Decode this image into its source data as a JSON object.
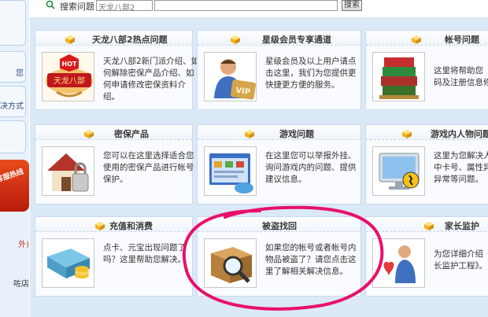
{
  "search": {
    "label": "搜索问题",
    "selected_scope": "天龙八部2",
    "query": "",
    "button_label": "搜索"
  },
  "sidebar": {
    "items": [
      {
        "label": ""
      },
      {
        "label": "您"
      },
      {
        "label": "决方式"
      },
      {
        "label": ""
      }
    ],
    "promo_text": "客服热线",
    "bottom_texts": [
      "外)",
      "咗店"
    ]
  },
  "cards": [
    {
      "title": "天龙八部2热点问题",
      "image": "hot-topic-icon",
      "desc": [
        "天龙八部2新门派介绍、如",
        "何解除密保产品介绍、如",
        "何申请修改密保资料介",
        "绍。"
      ]
    },
    {
      "title": "星级会员专享通道",
      "image": "vip-member-icon",
      "desc": [
        "星级会员及以上用户请点",
        "击这里，我们为您提供更",
        "快捷更方便的服务。"
      ]
    },
    {
      "title": "帐号问题",
      "image": "account-books-icon",
      "desc": [
        "这里将帮助您",
        "码及注册信息修"
      ]
    },
    {
      "title": "密保产品",
      "image": "security-house-icon",
      "desc": [
        "您可以在这里选择适合您",
        "使用的密保产品进行帐号",
        "保护。"
      ]
    },
    {
      "title": "游戏问题",
      "image": "game-window-icon",
      "desc": [
        "在这里您可以举报外挂、",
        "询问游戏内的问题、提供",
        "建议信息。"
      ]
    },
    {
      "title": "游戏内人物问题",
      "image": "character-monitor-icon",
      "desc": [
        "这里为您解决人",
        "中卡号、属性异",
        "异常等问题。"
      ]
    },
    {
      "title": "充值和消费",
      "image": "recharge-cards-icon",
      "desc": [
        "点卡、元宝出现问题了",
        "吗？这里帮助您解决。"
      ]
    },
    {
      "title": "被盗找回",
      "image": "stolen-recovery-box-icon",
      "desc": [
        "如果您的帐号或者帐号内",
        "物品被盗了？请您点击这",
        "里了解相关解决信息。"
      ]
    },
    {
      "title": "家长监护",
      "image": "parental-guard-icon",
      "desc": [
        "为您详细介绍《",
        "长监护工程》。"
      ]
    }
  ],
  "hot_badge": "HOT",
  "hot_banner": "天龙八部",
  "vip_text": "VIP",
  "colors": {
    "annotation": "#e8106a",
    "accent": "#2a4a73",
    "header_bg": "#eef4fb"
  }
}
